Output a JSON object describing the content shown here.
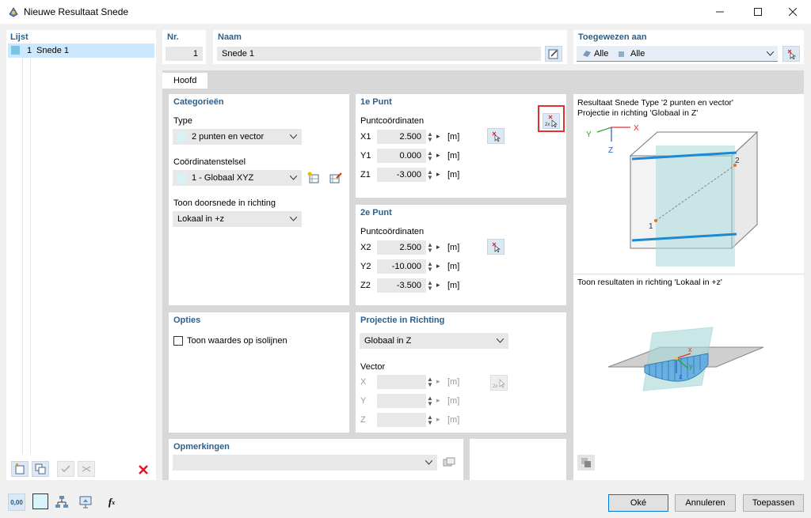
{
  "window": {
    "title": "Nieuwe Resultaat Snede"
  },
  "list": {
    "header": "Lijst",
    "items": [
      {
        "number": "1",
        "label": "Snede 1"
      }
    ]
  },
  "nr": {
    "label": "Nr.",
    "value": "1"
  },
  "naam": {
    "label": "Naam",
    "value": "Snede 1"
  },
  "toegewezen": {
    "label": "Toegewezen aan",
    "part1": "Alle",
    "part2": "Alle"
  },
  "tabs": [
    {
      "label": "Hoofd"
    }
  ],
  "categorieen": {
    "header": "Categorieën",
    "type_label": "Type",
    "type_value": "2 punten en vector",
    "coord_label": "Coördinatenstelsel",
    "coord_value": "1 - Globaal XYZ",
    "toon_label": "Toon doorsnede in richting",
    "toon_value": "Lokaal in +z"
  },
  "punt1": {
    "header": "1e Punt",
    "sub": "Puntcoördinaten",
    "rows": [
      {
        "label": "X1",
        "value": "2.500",
        "unit": "[m]"
      },
      {
        "label": "Y1",
        "value": "0.000",
        "unit": "[m]"
      },
      {
        "label": "Z1",
        "value": "-3.000",
        "unit": "[m]"
      }
    ]
  },
  "punt2": {
    "header": "2e Punt",
    "sub": "Puntcoördinaten",
    "rows": [
      {
        "label": "X2",
        "value": "2.500",
        "unit": "[m]"
      },
      {
        "label": "Y2",
        "value": "-10.000",
        "unit": "[m]"
      },
      {
        "label": "Z2",
        "value": "-3.500",
        "unit": "[m]"
      }
    ]
  },
  "projectie": {
    "header": "Projectie in Richting",
    "value": "Globaal in Z",
    "vector_label": "Vector",
    "rows": [
      {
        "label": "X",
        "unit": "[m]"
      },
      {
        "label": "Y",
        "unit": "[m]"
      },
      {
        "label": "Z",
        "unit": "[m]"
      }
    ]
  },
  "opties": {
    "header": "Opties",
    "checkbox_label": "Toon waardes op isolijnen",
    "checked": false
  },
  "opmerkingen": {
    "header": "Opmerkingen",
    "value": ""
  },
  "preview": {
    "line1": "Resultaat Snede Type '2 punten en vector'",
    "line2": "Projectie in richting 'Globaal in Z'",
    "line3": "Toon resultaten in richting 'Lokaal in +z'",
    "axis_x": "X",
    "axis_y": "Y",
    "axis_z": "Z",
    "point1": "1",
    "point2": "2",
    "small_x": "x",
    "small_y": "y",
    "small_z": "z"
  },
  "icons": {
    "pick": "pick-node-icon",
    "pick2": "pick-two-nodes-icon",
    "edit": "edit-icon",
    "new": "new-icon",
    "copy": "copy-icon",
    "delete": "delete-icon"
  },
  "footer": {
    "ok": "Oké",
    "cancel": "Annuleren",
    "apply": "Toepassen",
    "units_icon": "0,00"
  },
  "colors": {
    "accent": "#2c5f8a",
    "highlight": "#cce8ff",
    "red": "#e81123",
    "blue_line": "#1e88d0",
    "plane": "#a8d8d8"
  }
}
